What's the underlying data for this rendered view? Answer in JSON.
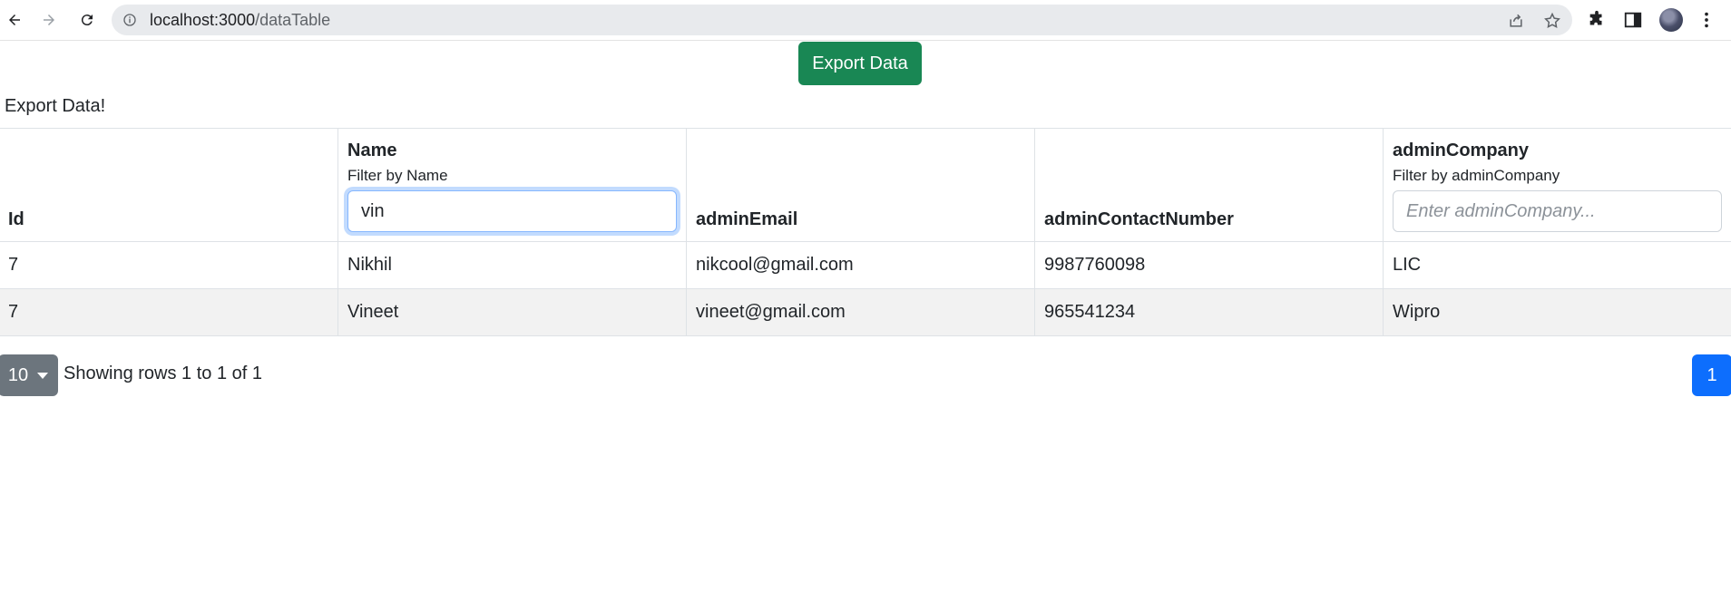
{
  "browser": {
    "url_host": "localhost:3000",
    "url_path": "/dataTable"
  },
  "page": {
    "export_button": "Export Data",
    "export_text": "Export Data!"
  },
  "table": {
    "columns": [
      {
        "title": "Id"
      },
      {
        "title": "Name",
        "filter_label": "Filter by Name",
        "filter_value": "vin",
        "filter_placeholder": ""
      },
      {
        "title": "adminEmail"
      },
      {
        "title": "adminContactNumber"
      },
      {
        "title": "adminCompany",
        "filter_label": "Filter by adminCompany",
        "filter_value": "",
        "filter_placeholder": "Enter adminCompany..."
      }
    ],
    "rows": [
      [
        "7",
        "Nikhil",
        "nikcool@gmail.com",
        "9987760098",
        "LIC"
      ],
      [
        "7",
        "Vineet",
        "vineet@gmail.com",
        "965541234",
        "Wipro"
      ]
    ]
  },
  "pagination": {
    "page_size": "10",
    "showing_text": "Showing rows 1 to 1 of 1",
    "current_page": "1"
  },
  "icons": {
    "back": "back-arrow-icon",
    "forward": "forward-arrow-icon",
    "reload": "reload-icon",
    "info": "info-icon",
    "share": "share-icon",
    "star": "star-icon",
    "extensions": "puzzle-icon",
    "sidepanel": "side-panel-icon",
    "menu": "kebab-menu-icon"
  }
}
